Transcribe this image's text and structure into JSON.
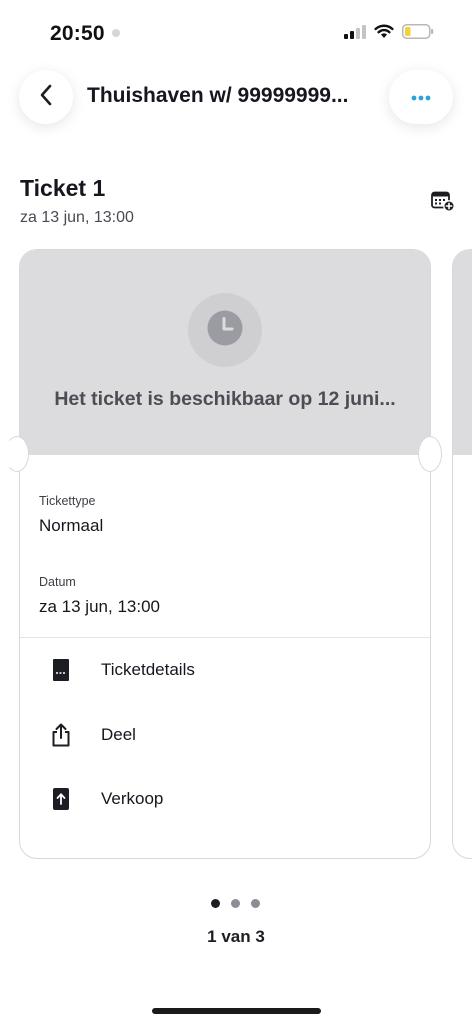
{
  "status_bar": {
    "time": "20:50",
    "icons": [
      "signal-icon",
      "wifi-icon",
      "battery-icon"
    ]
  },
  "header": {
    "back_icon": "chevron-left-icon",
    "title": "Thuishaven w/ 99999999...",
    "more_icon": "more-dots-icon",
    "accent_color": "#2aa3d8"
  },
  "ticket": {
    "title": "Ticket 1",
    "subtitle": "za 13 jun, 13:00",
    "calendar_icon": "add-to-calendar-icon",
    "availability": {
      "icon": "clock-icon",
      "text": "Het ticket is beschikbaar op 12 juni..."
    },
    "fields": [
      {
        "label": "Tickettype",
        "value": "Normaal"
      },
      {
        "label": "Datum",
        "value": "za 13 jun, 13:00"
      }
    ],
    "actions": [
      {
        "label": "Ticketdetails",
        "icon": "ticket-icon"
      },
      {
        "label": "Deel",
        "icon": "share-icon"
      },
      {
        "label": "Verkoop",
        "icon": "sell-icon"
      }
    ]
  },
  "pagination": {
    "current": 1,
    "total": 3,
    "label": "1 van 3"
  },
  "colors": {
    "card_top_bg": "#dcdcdf",
    "text_primary": "#16161e",
    "text_secondary": "#4a4a55"
  }
}
